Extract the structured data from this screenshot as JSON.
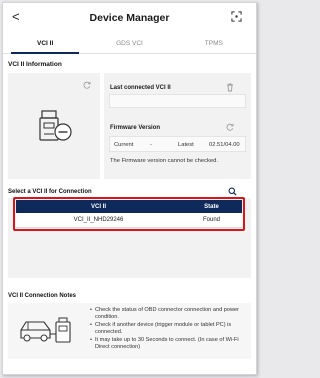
{
  "header": {
    "title": "Device Manager",
    "back_glyph": "<"
  },
  "tabs": [
    {
      "label": "VCI II",
      "active": true
    },
    {
      "label": "GDS VCI",
      "active": false
    },
    {
      "label": "TPMS",
      "active": false
    }
  ],
  "vci_info": {
    "section_title": "VCI II Information",
    "last_connected_label": "Last connected VCI II",
    "last_connected_value": "",
    "firmware_label": "Firmware Version",
    "current_label": "Current",
    "current_value": "-",
    "latest_label": "Latest",
    "latest_value": "02.51/04.00",
    "firmware_message": "The Firmware version cannot be checked."
  },
  "selection": {
    "section_title": "Select a VCI II for Connection",
    "columns": [
      "VCI II",
      "State"
    ],
    "rows": [
      {
        "name": "VCI_II_NHD29246",
        "state": "Found"
      }
    ]
  },
  "notes": {
    "section_title": "VCI II Connection Notes",
    "items": [
      "Check the status of OBD connector connection and power condition.",
      "Check if another device (trigger module or tablet PC) is connected.",
      "It may take up to 30 Seconds to connect. (In case of Wi-Fi Direct connection)"
    ]
  },
  "colors": {
    "accent": "#0d2a5a",
    "highlight": "#d9141b",
    "panel": "#f2f2f3"
  },
  "icons": [
    "back-icon",
    "scan-icon",
    "refresh-icon",
    "delete-icon",
    "search-icon",
    "vci-device-icon",
    "car-connection-icon"
  ]
}
